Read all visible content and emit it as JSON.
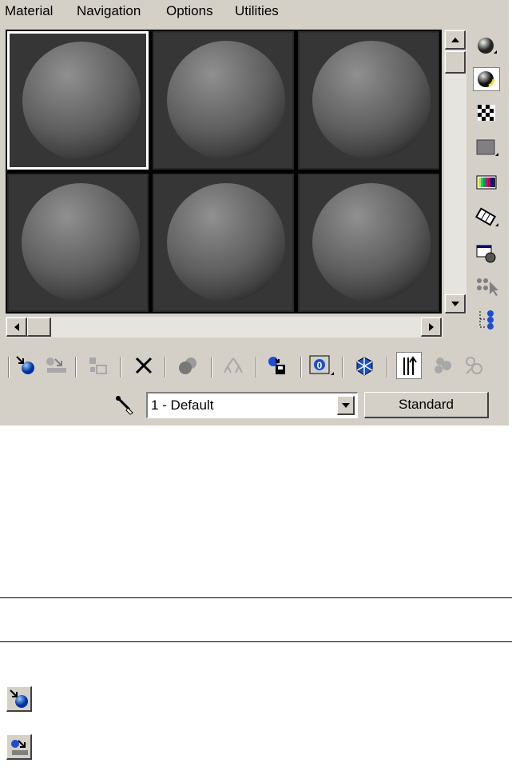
{
  "menu": {
    "items": [
      "Material",
      "Navigation",
      "Options",
      "Utilities"
    ]
  },
  "sample_slots": {
    "count": 6,
    "columns": 3,
    "active_index": 0
  },
  "side_toolbar": {
    "icons": [
      "sample-type-sphere-icon",
      "backlight-icon",
      "checker-background-icon",
      "sample-uv-tiling-icon",
      "video-color-check-icon",
      "make-preview-icon",
      "options-icon",
      "select-by-material-icon",
      "material-map-navigator-icon"
    ],
    "pressed_index": 1
  },
  "bottom_toolbar": {
    "icons": [
      "get-material-icon",
      "put-material-to-scene-icon",
      "assign-material-icon",
      "reset-map-icon",
      "make-unique-icon",
      "put-to-library-icon",
      "material-effects-channel-icon",
      "show-map-in-viewport-icon",
      "show-end-result-icon",
      "go-to-parent-icon",
      "go-forward-to-sibling-icon",
      "go-back-icon"
    ]
  },
  "material_name": {
    "value": "1 - Default"
  },
  "material_type": {
    "label": "Standard"
  },
  "colors": {
    "panel": "#d4d0c8",
    "slot_background": "#363636",
    "active_slot_border": "#ffffff"
  }
}
